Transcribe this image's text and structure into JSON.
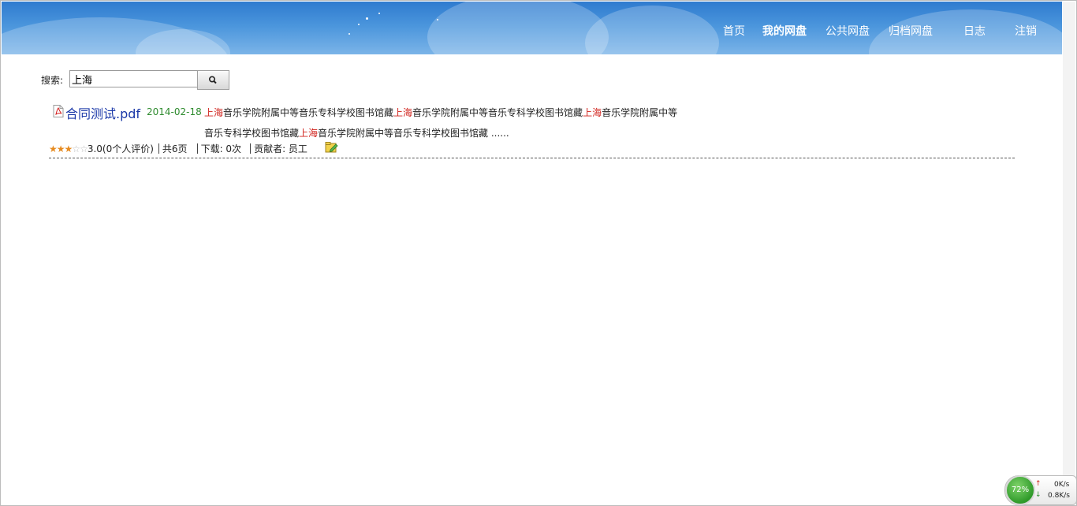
{
  "nav": {
    "items": [
      {
        "label": "首页"
      },
      {
        "label": "我的网盘"
      },
      {
        "label": "公共网盘"
      },
      {
        "label": "归档网盘"
      },
      {
        "label": "日志"
      },
      {
        "label": "注销"
      }
    ],
    "active": "我的网盘"
  },
  "search": {
    "label": "搜索:",
    "value": "上海",
    "button_icon": "search-icon"
  },
  "result": {
    "file_icon": "pdf-icon",
    "title": "合同测试.pdf",
    "date": "2014-02-18",
    "snippet_line1": [
      {
        "text": "上海",
        "hl": true
      },
      {
        "text": "音乐学院附属中等音乐专科学校图书馆藏",
        "hl": false
      },
      {
        "text": "上海",
        "hl": true
      },
      {
        "text": "音乐学院附属中等音乐专科学校图书馆藏",
        "hl": false
      },
      {
        "text": "上海",
        "hl": true
      },
      {
        "text": "音乐学院附属中等",
        "hl": false
      }
    ],
    "snippet_line2": [
      {
        "text": "音乐专科学校图书馆藏",
        "hl": false
      },
      {
        "text": "上海",
        "hl": true
      },
      {
        "text": "音乐学院附属中等音乐专科学校图书馆藏 ......",
        "hl": false
      }
    ],
    "rating": 3,
    "rating_max": 5,
    "rating_text": "3.0(0个人评价)",
    "pages": "共6页",
    "downloads": "下载: 0次",
    "contributor": "贡献者: 员工",
    "action_icon": "edit-icon"
  },
  "widget": {
    "percent": "72%",
    "up": "0K/s",
    "down": "0.8K/s"
  },
  "colors": {
    "header": "#3f8ad6",
    "highlight": "#d0211b",
    "title": "#1a38a8",
    "date": "#2e8b2e",
    "star": "#e68a1f"
  }
}
